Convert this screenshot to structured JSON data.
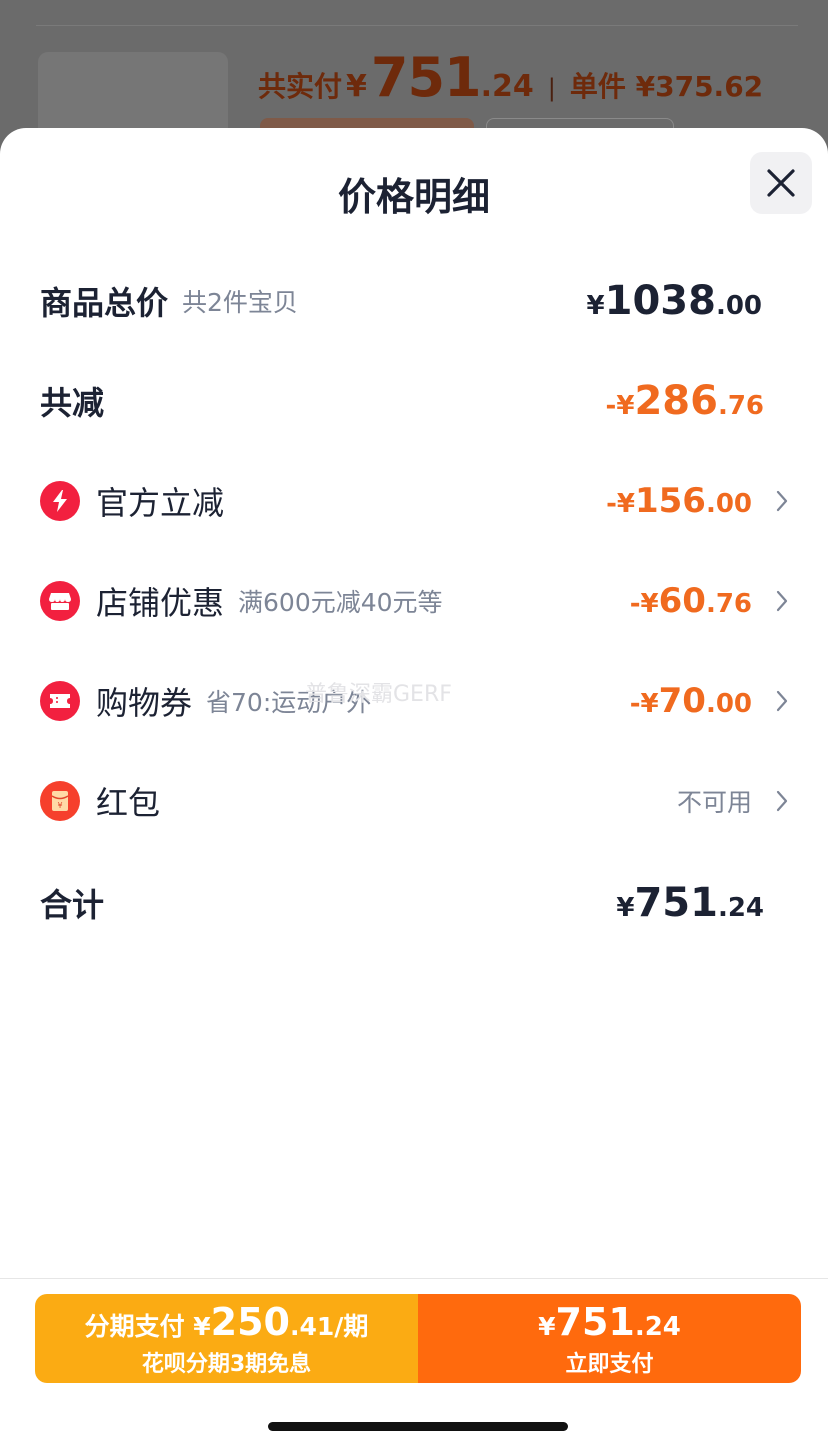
{
  "background_page": {
    "total_label": "共实付",
    "currency": "¥",
    "total_int": "751",
    "total_dec": ".24",
    "separator": "|",
    "unit_price": "单件 ¥375.62"
  },
  "sheet": {
    "title": "价格明细"
  },
  "rows": {
    "goods_total": {
      "label": "商品总价",
      "sub": "共2件宝贝",
      "yen": "¥",
      "int": "1038",
      "dec": ".00"
    },
    "total_discount": {
      "label": "共减",
      "yen": "-¥",
      "int": "286",
      "dec": ".76"
    },
    "official": {
      "label": "官方立减",
      "yen": "-¥",
      "int": "156",
      "dec": ".00"
    },
    "store": {
      "label": "店铺优惠",
      "sub": "满600元减40元等",
      "yen": "-¥",
      "int": "60",
      "dec": ".76"
    },
    "coupon": {
      "label": "购物券",
      "sub": "省70:运动户外",
      "yen": "-¥",
      "int": "70",
      "dec": ".00"
    },
    "redpacket": {
      "label": "红包",
      "status": "不可用"
    },
    "sum": {
      "label": "合计",
      "yen": "¥",
      "int": "751",
      "dec": ".24"
    }
  },
  "watermark": "普鲁深霸GERF",
  "pay": {
    "installment": {
      "label": "分期支付 ¥",
      "int": "250",
      "dec": ".41/期",
      "sub": "花呗分期3期免息"
    },
    "now": {
      "yen": "¥",
      "int": "751",
      "dec": ".24",
      "label": "立即支付"
    }
  },
  "colors": {
    "accent": "#f06a1f",
    "installment_bg": "#fbab13",
    "pay_bg": "#ff6a0d",
    "badge_red": "#f2203f"
  }
}
